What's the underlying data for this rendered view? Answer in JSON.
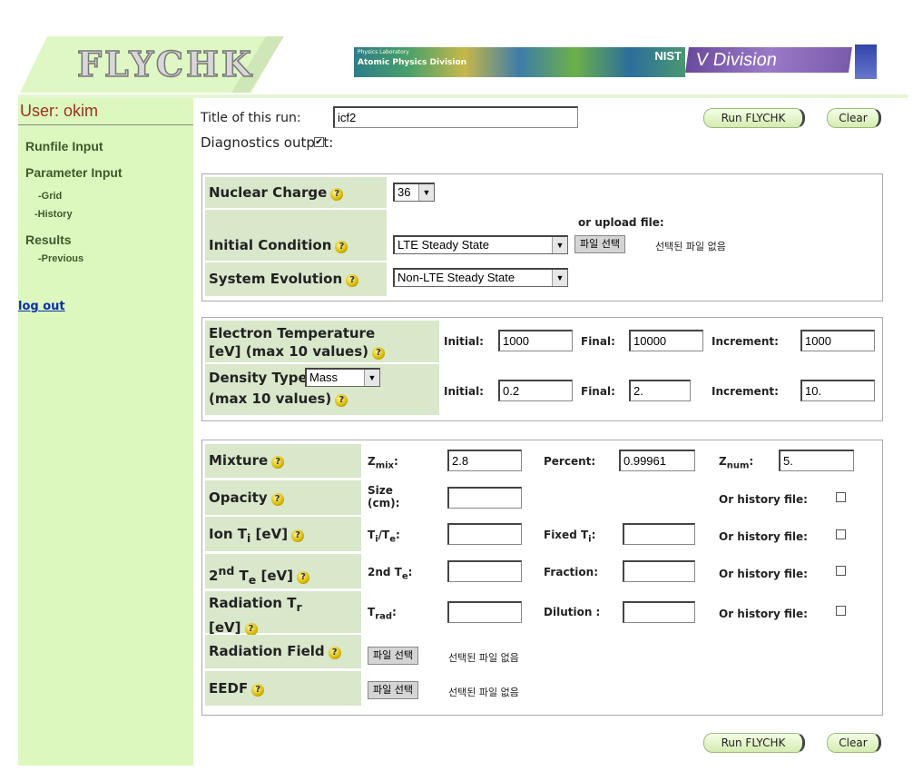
{
  "header": {
    "logo": "FLYCHK",
    "banner_lab": "Physics Laboratory",
    "banner_division": "Atomic Physics Division",
    "banner_nist": "NIST",
    "banner_vdiv": "V Division"
  },
  "sidebar": {
    "user": "User: okim",
    "items": [
      {
        "label": "Runfile Input"
      },
      {
        "label": "Parameter Input"
      },
      {
        "label": "-Grid"
      },
      {
        "label": "-History"
      },
      {
        "label": "Results"
      },
      {
        "label": "-Previous"
      }
    ],
    "logout": "log out"
  },
  "form": {
    "title_label": "Title of this run:",
    "title_value": "icf2",
    "diag_label": "Diagnostics output:",
    "diag_checked": true,
    "run_label": "Run FLYCHK",
    "clear_label": "Clear",
    "nuclear_charge": {
      "label": "Nuclear Charge",
      "value": "36"
    },
    "initial_condition": {
      "label": "Initial Condition",
      "value": "LTE Steady State",
      "upload_label": "or upload file:"
    },
    "system_evolution": {
      "label": "System Evolution",
      "value": "Non-LTE Steady State"
    },
    "file_button": "파일 선택",
    "no_file": "선택된 파일 없음",
    "temp": {
      "label1": "Electron Temperature",
      "label2": "[eV] (max 10 values)",
      "initial_label": "Initial:",
      "initial": "1000",
      "final_label": "Final:",
      "final": "10000",
      "inc_label": "Increment:",
      "increment": "1000"
    },
    "density": {
      "label1": "Density Type",
      "type": "Mass",
      "label2": "(max 10 values)",
      "initial_label": "Initial:",
      "initial": "0.2",
      "final_label": "Final:",
      "final": "2.",
      "inc_label": "Increment:",
      "increment": "10."
    },
    "mixture": {
      "label": "Mixture",
      "zmix_label": "Z",
      "zmix_sub": "mix",
      "zmix_suffix": ":",
      "zmix": "2.8",
      "percent_label": "Percent:",
      "percent": "0.99961",
      "znum_label": "Z",
      "znum_sub": "num",
      "znum_suffix": ":",
      "znum": "5."
    },
    "opacity": {
      "label": "Opacity",
      "size_label1": "Size",
      "size_label2": "(cm):"
    },
    "ion": {
      "label": "Ion T",
      "sub": "i",
      "unit": " [eV]",
      "ratio_label": "T",
      "ratio_sub1": "i",
      "ratio_mid": "/T",
      "ratio_sub2": "e",
      "ratio_suffix": ":",
      "fixed_label": "Fixed T",
      "fixed_sub": "i",
      "fixed_suffix": ":"
    },
    "te2": {
      "label_pre": "2",
      "label_sup": "nd",
      "label_t": " T",
      "label_sub": "e",
      "label_unit": " [eV]",
      "field_label": "2nd T",
      "field_sub": "e",
      "field_suffix": ":",
      "fraction_label": "Fraction:"
    },
    "radiation": {
      "label": "Radiation T",
      "sub": "r",
      "unit": "[eV]",
      "trad_label": "T",
      "trad_sub": "rad",
      "trad_suffix": ":",
      "dilution_label": "Dilution :"
    },
    "history_label": "Or history file:",
    "radiation_field": {
      "label": "Radiation Field"
    },
    "eedf": {
      "label": "EEDF"
    }
  },
  "help_glyph": "?"
}
